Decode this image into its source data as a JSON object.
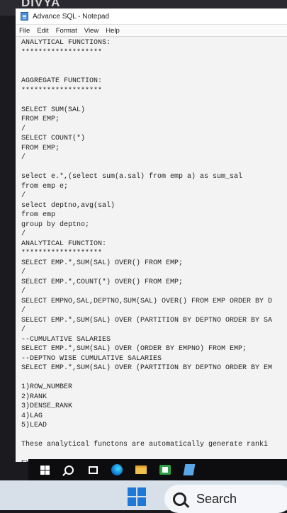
{
  "top_label": "DIVYA",
  "window": {
    "title": "Advance SQL - Notepad",
    "menu": [
      "File",
      "Edit",
      "Format",
      "View",
      "Help"
    ]
  },
  "editor": {
    "lines": [
      "ANALYTICAL FUNCTIONS:",
      "*******************",
      "",
      "",
      "AGGREGATE FUNCTION:",
      "*******************",
      "",
      "SELECT SUM(SAL)",
      "FROM EMP;",
      "/",
      "SELECT COUNT(*)",
      "FROM EMP;",
      "/",
      "",
      "select e.*,(select sum(a.sal) from emp a) as sum_sal",
      "from emp e;",
      "/",
      "select deptno,avg(sal)",
      "from emp",
      "group by deptno;",
      "/",
      "ANALYTICAL FUNCTION:",
      "*******************",
      "SELECT EMP.*,SUM(SAL) OVER() FROM EMP;",
      "/",
      "SELECT EMP.*,COUNT(*) OVER() FROM EMP;",
      "/",
      "SELECT EMPNO,SAL,DEPTNO,SUM(SAL) OVER() FROM EMP ORDER BY D",
      "/",
      "SELECT EMP.*,SUM(SAL) OVER (PARTITION BY DEPTNO ORDER BY SA",
      "/",
      "--CUMULATIVE SALARIES",
      "SELECT EMP.*,SUM(SAL) OVER (ORDER BY EMPNO) FROM EMP;",
      "--DEPTNO WISE CUMULATIVE SALARIES",
      "SELECT EMP.*,SUM(SAL) OVER (PARTITION BY DEPTNO ORDER BY EM",
      "",
      "1)ROW_NUMBER",
      "2)RANK",
      "3)DENSE_RANK",
      "4)LAG",
      "5)LEAD",
      "",
      "These analytical functons are automatically generate ranki",
      "",
      "EX:"
    ]
  },
  "taskbar": {
    "icons": [
      "windows-icon",
      "search-icon",
      "task-view-icon",
      "edge-icon",
      "file-explorer-icon",
      "store-icon",
      "notepad-icon"
    ]
  },
  "bottom_search": {
    "label": "Search"
  }
}
